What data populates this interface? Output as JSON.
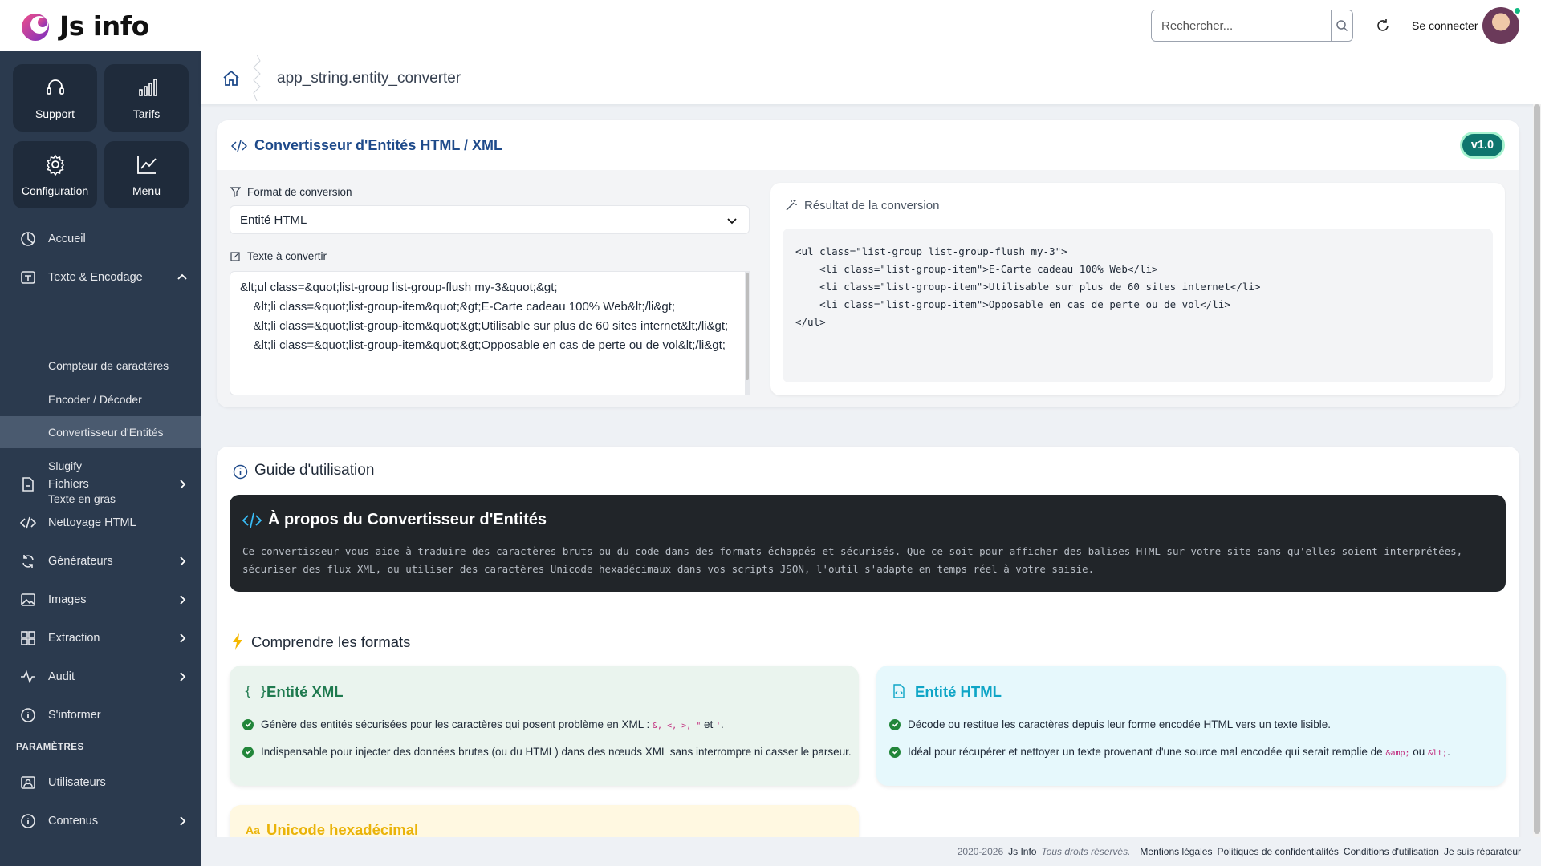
{
  "header": {
    "logo_text": "Js info",
    "search_placeholder": "Rechercher...",
    "login_label": "Se connecter"
  },
  "sidebar": {
    "tiles": [
      {
        "label": "Support",
        "icon": "headset-icon"
      },
      {
        "label": "Tarifs",
        "icon": "bar-chart-icon"
      },
      {
        "label": "Configuration",
        "icon": "gear-icon"
      },
      {
        "label": "Menu",
        "icon": "trend-chart-icon"
      }
    ],
    "items": [
      {
        "label": "Accueil",
        "icon": "pie-icon"
      },
      {
        "label": "Texte & Encodage",
        "icon": "text-box-icon",
        "expanded": true
      },
      {
        "label": "Fichiers",
        "icon": "file-icon"
      },
      {
        "label": "Nettoyage HTML",
        "icon": "code-icon"
      },
      {
        "label": "Générateurs",
        "icon": "refresh-cycle-icon"
      },
      {
        "label": "Images",
        "icon": "image-icon"
      },
      {
        "label": "Extraction",
        "icon": "grid-icon"
      },
      {
        "label": "Audit",
        "icon": "pulse-icon"
      },
      {
        "label": "S'informer",
        "icon": "info-icon"
      }
    ],
    "sub_items": [
      {
        "label": "Compteur de caractères"
      },
      {
        "label": "Encoder / Décoder"
      },
      {
        "label": "Convertisseur d'Entités",
        "active": true
      },
      {
        "label": "Slugify"
      },
      {
        "label": "Texte en gras"
      }
    ],
    "settings_title": "PARAMÈTRES",
    "settings_items": [
      {
        "label": "Utilisateurs",
        "icon": "users-icon"
      },
      {
        "label": "Contenus",
        "icon": "info-icon"
      }
    ]
  },
  "breadcrumb": {
    "current": "app_string.entity_converter"
  },
  "converter": {
    "title": "Convertisseur d'Entités HTML / XML",
    "version": "v1.0",
    "format_label": "Format de conversion",
    "format_value": "Entité HTML",
    "input_label": "Texte à convertir",
    "input_lines": [
      "&lt;ul class=&quot;list-group list-group-flush my-3&quot;&gt;",
      "    &lt;li class=&quot;list-group-item&quot;&gt;E-Carte cadeau 100% Web&lt;/li&gt;",
      "    &lt;li class=&quot;list-group-item&quot;&gt;Utilisable sur plus de 60 sites internet&lt;/li&gt;",
      "    &lt;li class=&quot;list-group-item&quot;&gt;Opposable en cas de perte ou de vol&lt;/li&gt;"
    ],
    "result_label": "Résultat de la conversion",
    "result_lines": [
      "<ul class=\"list-group list-group-flush my-3\">",
      "    <li class=\"list-group-item\">E-Carte cadeau 100% Web</li>",
      "    <li class=\"list-group-item\">Utilisable sur plus de 60 sites internet</li>",
      "    <li class=\"list-group-item\">Opposable en cas de perte ou de vol</li>",
      "</ul>"
    ]
  },
  "guide": {
    "title": "Guide d'utilisation",
    "about_title": "À propos du Convertisseur d'Entités",
    "about_text": "Ce convertisseur vous aide à traduire des caractères bruts ou du code dans des formats échappés et sécurisés. Que ce soit pour afficher des balises HTML sur votre site sans qu'elles soient interprétées, sécuriser des flux XML, ou utiliser des caractères Unicode hexadécimaux dans vos scripts JSON, l'outil s'adapte en temps réel à votre saisie.",
    "formats_title": "Comprendre les formats",
    "xml": {
      "title": "Entité XML",
      "bullet1_prefix": "Génère des entités sécurisées pour les caractères qui posent problème en XML : ",
      "bullet1_codes": "&, <, >, \"",
      "bullet1_mid": " et ",
      "bullet1_code2": "'",
      "bullet1_end": ".",
      "bullet2": "Indispensable pour injecter des données brutes (ou du HTML) dans des nœuds XML sans interrompre ni casser le parseur."
    },
    "html": {
      "title": "Entité HTML",
      "bullet1": "Décode ou restitue les caractères depuis leur forme encodée HTML vers un texte lisible.",
      "bullet2_prefix": "Idéal pour récupérer et nettoyer un texte provenant d'une source mal encodée qui serait remplie de ",
      "bullet2_code1": "&amp;",
      "bullet2_mid": " ou ",
      "bullet2_code2": "&lt;",
      "bullet2_end": "."
    },
    "unicode": {
      "title": "Unicode hexadécimal",
      "icon_text": "Aa"
    }
  },
  "footer": {
    "copyright": "2020-2026",
    "brand": "Js Info",
    "rights": "Tous droits réservés.",
    "links": [
      "Mentions légales",
      "Politiques de confidentialités",
      "Conditions d'utilisation",
      "Je suis réparateur"
    ]
  },
  "colors": {
    "sidebar_bg": "#2b3a4e",
    "accent_blue": "#1e4a8a",
    "badge_teal": "#0f766e",
    "xml_green": "#1f7a4f",
    "html_cyan": "#0ea5c6",
    "unicode_amber": "#eab308"
  }
}
